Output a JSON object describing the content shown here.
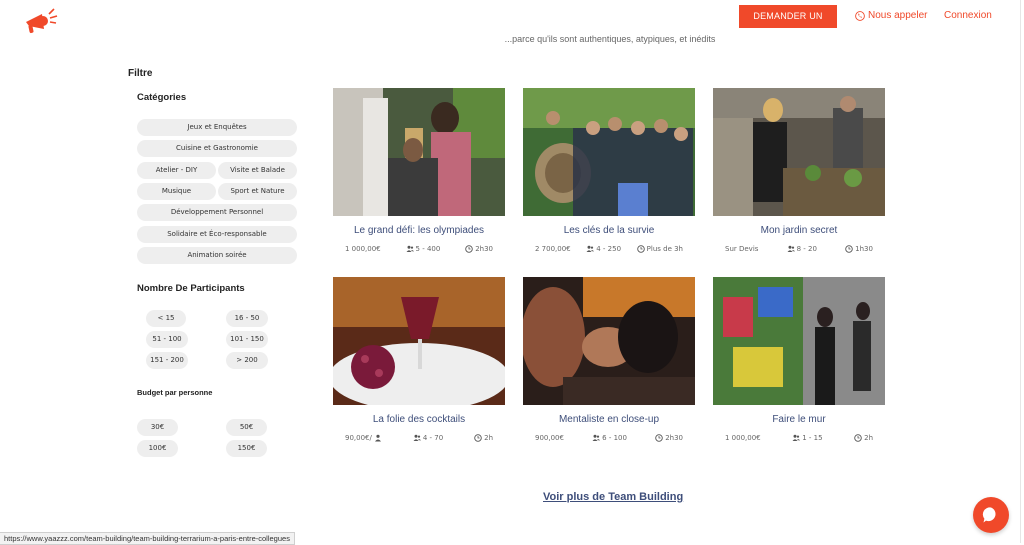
{
  "header": {
    "tagline": "...parce qu'ils sont authentiques, atypiques, et inédits",
    "devis_button": "DEMANDER UN DEVIS",
    "call_link": "Nous appeler",
    "login_link": "Connexion",
    "logo_icon": "megaphone-icon"
  },
  "sidebar": {
    "title": "Filtre",
    "categories_title": "Catégories",
    "categories": [
      "Jeux et Enquêtes",
      "Cuisine et Gastronomie",
      "Atelier - DIY",
      "Visite et Balade",
      "Musique",
      "Sport et Nature",
      "Développement Personnel",
      "Solidaire et Éco-responsable",
      "Animation soirée"
    ],
    "participants_title": "Nombre De Participants",
    "participants": [
      "< 15",
      "16 - 50",
      "51 - 100",
      "101 - 150",
      "151 - 200",
      "> 200"
    ],
    "budget_title": "Budget par personne",
    "budgets": [
      "30€",
      "50€",
      "100€",
      "150€"
    ]
  },
  "cards": [
    {
      "title": "Le grand défi: les olympiades",
      "price": "1 000,00€",
      "people": "5 - 400",
      "duration": "2h30"
    },
    {
      "title": "Les clés de la survie",
      "price": "2 700,00€",
      "people": "4 - 250",
      "duration": "Plus de 3h"
    },
    {
      "title": "Mon jardin secret",
      "price": "Sur Devis",
      "people": "8 - 20",
      "duration": "1h30"
    },
    {
      "title": "La folie des cocktails",
      "price": "90,00€/",
      "people": "4 - 70",
      "duration": "2h"
    },
    {
      "title": "Mentaliste en close-up",
      "price": "900,00€",
      "people": "6 - 100",
      "duration": "2h30"
    },
    {
      "title": "Faire le mur",
      "price": "1 000,00€",
      "people": "1 - 15",
      "duration": "2h"
    }
  ],
  "see_more": "Voir plus de Team Building",
  "status_url": "https://www.yaazzz.com/team-building/team-building-terrarium-a-paris-entre-collegues",
  "colors": {
    "accent": "#f0492a",
    "title_blue": "#3e4e7a",
    "pill_bg": "#eeeeee"
  },
  "icons": {
    "people": "users-icon",
    "duration": "clock-icon",
    "phone": "phone-icon",
    "chat": "chat-icon",
    "per_person": "user-icon"
  }
}
